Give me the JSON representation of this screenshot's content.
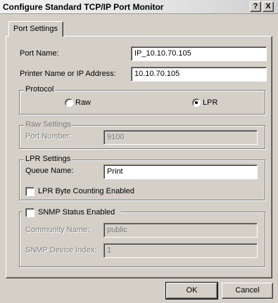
{
  "window": {
    "title": "Configure Standard TCP/IP Port Monitor",
    "help_label": "?",
    "close_label": "X"
  },
  "tabs": [
    {
      "label": "Port Settings",
      "selected": true
    }
  ],
  "port_settings": {
    "port_name_label": "Port Name:",
    "port_name_value": "IP_10.10.70.105",
    "printer_address_label": "Printer Name or IP Address:",
    "printer_address_value": "10.10.70.105"
  },
  "protocol": {
    "title": "Protocol",
    "options": [
      {
        "label": "Raw",
        "selected": false
      },
      {
        "label": "LPR",
        "selected": true
      }
    ]
  },
  "raw_settings": {
    "title": "Raw Settings",
    "port_number_label": "Port Number:",
    "port_number_value": "9100",
    "enabled": false
  },
  "lpr_settings": {
    "title": "LPR Settings",
    "queue_name_label": "Queue Name:",
    "queue_name_value": "Print",
    "byte_counting_label": "LPR Byte Counting Enabled",
    "byte_counting_checked": false
  },
  "snmp": {
    "title": "SNMP Status Enabled",
    "checked": false,
    "community_name_label": "Community Name:",
    "community_name_value": "public",
    "device_index_label": "SNMP Device Index:",
    "device_index_value": "1"
  },
  "buttons": {
    "ok_label": "OK",
    "cancel_label": "Cancel"
  }
}
